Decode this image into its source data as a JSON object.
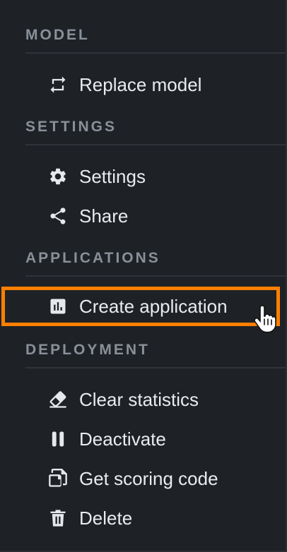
{
  "sections": {
    "model": {
      "title": "MODEL"
    },
    "settings": {
      "title": "SETTINGS"
    },
    "applications": {
      "title": "APPLICATIONS"
    },
    "deployment": {
      "title": "DEPLOYMENT"
    }
  },
  "items": {
    "replace_model": {
      "label": "Replace model",
      "icon": "swap-arrows-icon"
    },
    "settings": {
      "label": "Settings",
      "icon": "gear-icon"
    },
    "share": {
      "label": "Share",
      "icon": "share-icon"
    },
    "create_application": {
      "label": "Create application",
      "icon": "chart-icon"
    },
    "clear_statistics": {
      "label": "Clear statistics",
      "icon": "eraser-icon"
    },
    "deactivate": {
      "label": "Deactivate",
      "icon": "pause-icon"
    },
    "get_scoring_code": {
      "label": "Get scoring code",
      "icon": "copy-icon"
    },
    "delete": {
      "label": "Delete",
      "icon": "trash-icon"
    }
  },
  "colors": {
    "background": "#1e2226",
    "text": "#e9ebee",
    "header": "#8a9099",
    "highlight": "#ff7f00"
  }
}
